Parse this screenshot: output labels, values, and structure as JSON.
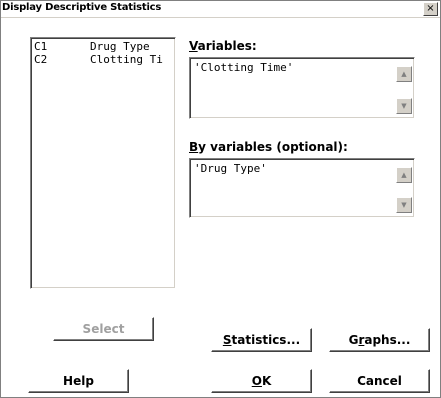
{
  "window": {
    "title": "Display Descriptive Statistics",
    "close_glyph": "×"
  },
  "variable_list": {
    "rows": [
      {
        "col": "C1",
        "name": "Drug Type"
      },
      {
        "col": "C2",
        "name": "Clotting Ti"
      }
    ]
  },
  "variables": {
    "label": "Variables:",
    "value": "'Clotting Time'"
  },
  "by_variables": {
    "label": "By variables (optional):",
    "value": "'Drug Type'"
  },
  "scrollbar": {
    "up_icon": "▲",
    "down_icon": "▼"
  },
  "buttons": {
    "select": "Select",
    "statistics": "Statistics...",
    "graphs": "Graphs...",
    "help": "Help",
    "ok": "OK",
    "cancel": "Cancel"
  }
}
